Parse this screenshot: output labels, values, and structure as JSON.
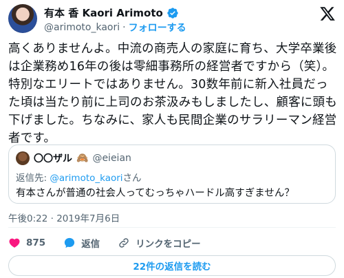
{
  "author": {
    "display_name": "有本 香 Kaori Arimoto",
    "handle": "@arimoto_kaori",
    "separator": "·",
    "follow_label": "フォローする"
  },
  "tweet": {
    "text": "高くありませんよ。中流の商売人の家庭に育ち、大学卒業後は企業務め16年の後は零細事務所の経営者ですから（笑）。特別なエリートではありません。30数年前に新入社員だった頃は当たり前に上司のお茶汲みもしましたし、顧客に頭も下げました。ちなみに、家人も民間企業のサラリーマン経営者です。"
  },
  "quoted": {
    "display_name": "〇〇ザル",
    "emoji": "🙈",
    "handle": "@eieian",
    "reply_prefix": "返信先: ",
    "reply_mention": "@arimoto_kaori",
    "reply_suffix": "さん",
    "text": "有本さんが普通の社会人ってむっちゃハードル高すぎません？"
  },
  "meta": {
    "timestamp": "午後0:22 · 2019年7月6日"
  },
  "actions": {
    "like_count": "875",
    "reply_label": "返信",
    "copy_link_label": "リンクをコピー"
  },
  "read_replies_label": "22件の返信を読む",
  "colors": {
    "like": "#f91880",
    "reply": "#1d9bf0",
    "accent": "#1d9bf0",
    "text": "#0f1419",
    "muted": "#536471"
  },
  "icons": {
    "verified": "verified-badge-icon",
    "logo": "x-logo-icon",
    "like": "heart-icon",
    "reply": "reply-bubble-icon",
    "link": "link-icon"
  }
}
